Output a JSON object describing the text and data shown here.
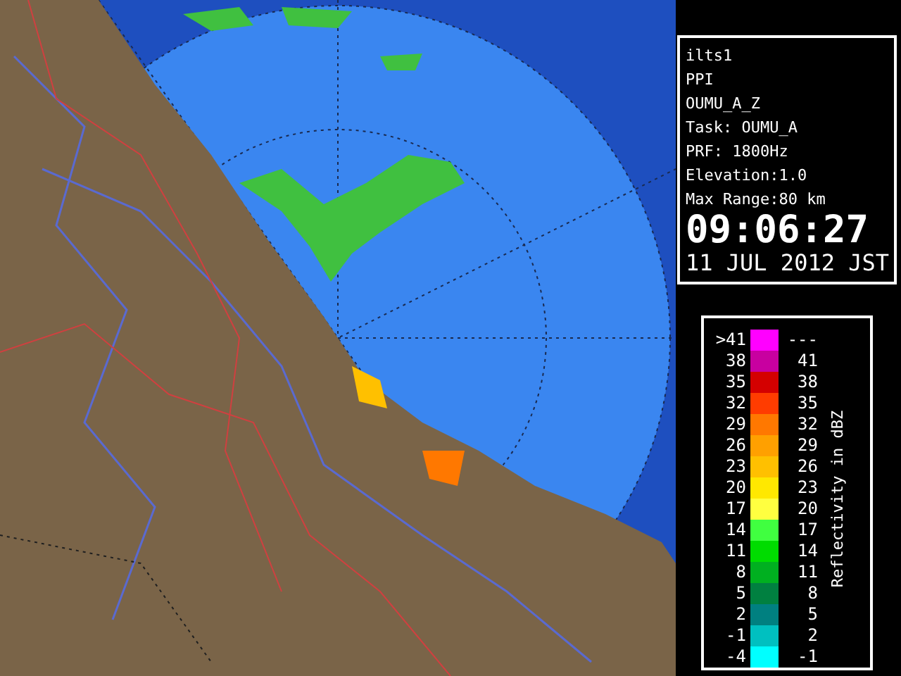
{
  "info": {
    "lines": [
      "ilts1",
      "PPI",
      "OUMU_A_Z",
      "Task: OUMU_A",
      "PRF: 1800Hz",
      "Elevation:1.0",
      "Max Range:80 km"
    ],
    "time": "09:06:27",
    "date": "11 JUL 2012 JST"
  },
  "legend": {
    "title": "Reflectivity in dBZ",
    "rows": [
      {
        "low": ">41",
        "high": "---",
        "color": "#ff00ff"
      },
      {
        "low": "38",
        "high": "41",
        "color": "#c800a0"
      },
      {
        "low": "35",
        "high": "38",
        "color": "#d40000"
      },
      {
        "low": "32",
        "high": "35",
        "color": "#ff3c00"
      },
      {
        "low": "29",
        "high": "32",
        "color": "#ff7800"
      },
      {
        "low": "26",
        "high": "29",
        "color": "#ffa000"
      },
      {
        "low": "23",
        "high": "26",
        "color": "#ffc000"
      },
      {
        "low": "20",
        "high": "23",
        "color": "#ffe800"
      },
      {
        "low": "17",
        "high": "20",
        "color": "#ffff40"
      },
      {
        "low": "14",
        "high": "17",
        "color": "#40ff40"
      },
      {
        "low": "11",
        "high": "14",
        "color": "#00dc00"
      },
      {
        "low": "8",
        "high": "11",
        "color": "#00b020"
      },
      {
        "low": "5",
        "high": "8",
        "color": "#008040"
      },
      {
        "low": "2",
        "high": "5",
        "color": "#008080"
      },
      {
        "low": "-1",
        "high": "2",
        "color": "#00c0c0"
      },
      {
        "low": "-4",
        "high": "-1",
        "color": "#00ffff"
      }
    ]
  }
}
